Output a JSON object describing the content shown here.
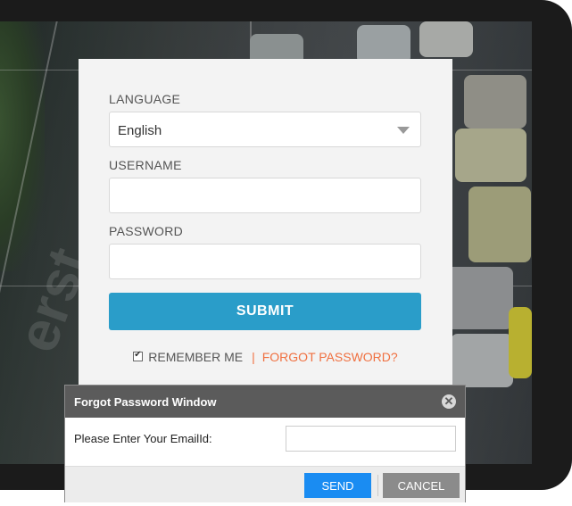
{
  "login": {
    "language_label": "LANGUAGE",
    "language_value": "English",
    "username_label": "USERNAME",
    "username_value": "",
    "password_label": "PASSWORD",
    "password_value": "",
    "submit_label": "SUBMIT",
    "remember_label": "REMEMBER ME",
    "remember_checked": true,
    "separator": "|",
    "forgot_label": "FORGOT PASSWORD?"
  },
  "dialog": {
    "title": "Forgot Password Window",
    "close_icon": "close-icon",
    "email_label": "Please Enter Your EmailId:",
    "email_value": "",
    "send_label": "SEND",
    "cancel_label": "CANCEL"
  },
  "colors": {
    "submit": "#2a9dc9",
    "forgot_link": "#f07040",
    "send_button": "#1a8cf2",
    "cancel_button": "#8b8b8b",
    "dialog_header": "#5b5b5b"
  }
}
